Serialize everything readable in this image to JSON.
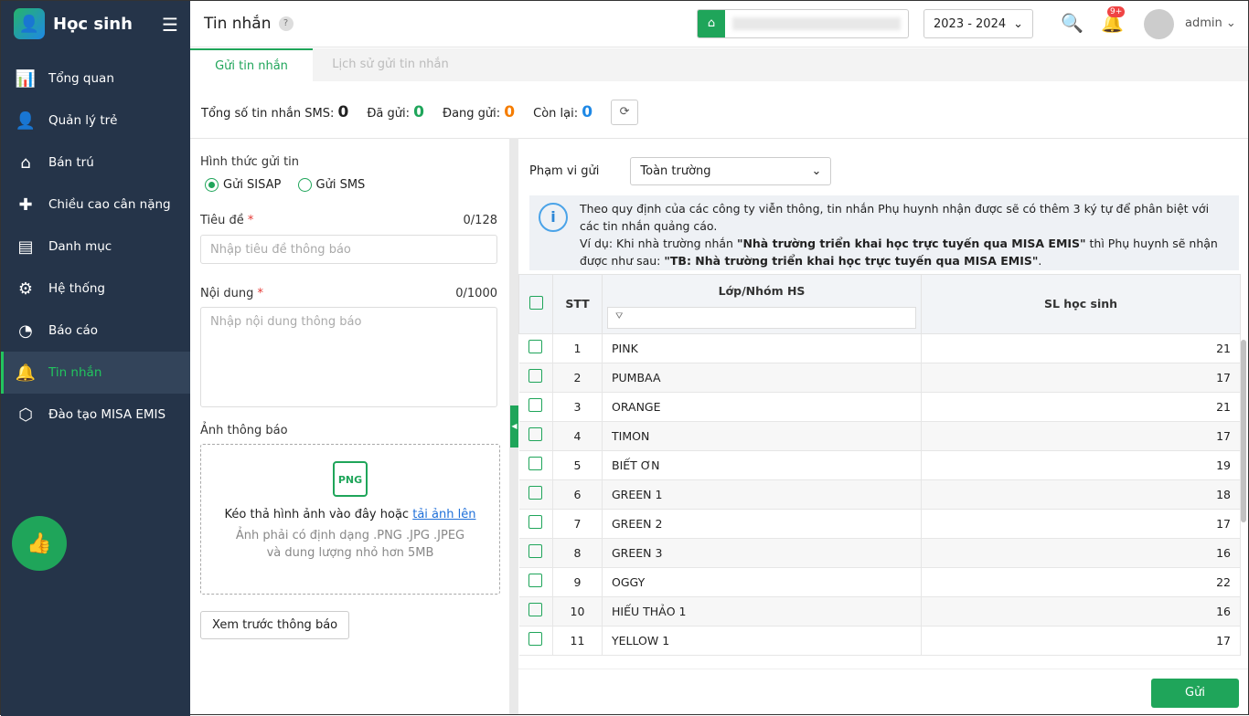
{
  "sidebar": {
    "app_title": "Học sinh",
    "items": [
      {
        "label": "Tổng quan",
        "icon": "chart-icon"
      },
      {
        "label": "Quản lý trẻ",
        "icon": "student-icon"
      },
      {
        "label": "Bán trú",
        "icon": "home-icon"
      },
      {
        "label": "Chiều cao cân nặng",
        "icon": "health-icon"
      },
      {
        "label": "Danh mục",
        "icon": "folder-icon"
      },
      {
        "label": "Hệ thống",
        "icon": "gear-icon"
      },
      {
        "label": "Báo cáo",
        "icon": "pie-icon"
      },
      {
        "label": "Tin nhắn",
        "icon": "bell-icon"
      },
      {
        "label": "Đào tạo MISA EMIS",
        "icon": "box-icon"
      }
    ]
  },
  "header": {
    "title": "Tin nhắn",
    "help": "?",
    "year": "2023 - 2024",
    "notif_badge": "9+",
    "user": "admin"
  },
  "tabs": [
    "Gửi tin nhắn",
    "Lịch sử gửi tin nhắn"
  ],
  "stats": {
    "total_label": "Tổng số tin nhắn SMS:",
    "total": "0",
    "sent_label": "Đã gửi:",
    "sent": "0",
    "sending_label": "Đang gửi:",
    "sending": "0",
    "remain_label": "Còn lại:",
    "remain": "0"
  },
  "colors": {
    "accent": "#1fa55a",
    "sidebar": "#253449",
    "orange": "#f57c00",
    "blue": "#1e88e5"
  },
  "form": {
    "send_type_label": "Hình thức gửi tin",
    "opt_sisap": "Gửi SISAP",
    "opt_sms": "Gửi SMS",
    "title_label": "Tiêu đề",
    "title_count": "0/128",
    "title_placeholder": "Nhập tiêu đề thông báo",
    "content_label": "Nội dung",
    "content_count": "0/1000",
    "content_placeholder": "Nhập nội dung thông báo",
    "image_label": "Ảnh thông báo",
    "png": "PNG",
    "drop_text": "Kéo thả hình ảnh vào đây hoặc",
    "upload_link": "tải ảnh lên",
    "drop_hint": "Ảnh phải có định dạng .PNG .JPG .JPEG và dung lượng nhỏ hơn 5MB",
    "preview_btn": "Xem trước thông báo",
    "required": "*"
  },
  "right": {
    "scope_label": "Phạm vi gửi",
    "scope_value": "Toàn trường",
    "info_line1": "Theo quy định của các công ty viễn thông, tin nhắn Phụ huynh nhận được sẽ có thêm 3 ký tự để phân biệt với các tin nhắn quảng cáo.",
    "info_ex_pre": "Ví dụ: Khi nhà trường nhắn ",
    "info_ex_bold1": "\"Nhà trường triển khai học trực tuyến qua MISA EMIS\"",
    "info_ex_mid": " thì Phụ huynh sẽ nhận được như sau: ",
    "info_ex_bold2": "\"TB: Nhà trường triển khai học trực tuyến qua MISA EMIS\"",
    "info_ex_end": ".",
    "send": "Gửi"
  },
  "table": {
    "headers": {
      "stt": "STT",
      "class": "Lớp/Nhóm HS",
      "count": "SL học sinh"
    },
    "rows": [
      {
        "stt": "1",
        "name": "PINK",
        "count": "21"
      },
      {
        "stt": "2",
        "name": "PUMBAA",
        "count": "17"
      },
      {
        "stt": "3",
        "name": "ORANGE",
        "count": "21"
      },
      {
        "stt": "4",
        "name": "TIMON",
        "count": "17"
      },
      {
        "stt": "5",
        "name": "BIẾT ƠN",
        "count": "19"
      },
      {
        "stt": "6",
        "name": "GREEN 1",
        "count": "18"
      },
      {
        "stt": "7",
        "name": "GREEN 2",
        "count": "17"
      },
      {
        "stt": "8",
        "name": "GREEN 3",
        "count": "16"
      },
      {
        "stt": "9",
        "name": "OGGY",
        "count": "22"
      },
      {
        "stt": "10",
        "name": "HIẾU THẢO 1",
        "count": "16"
      },
      {
        "stt": "11",
        "name": "YELLOW 1",
        "count": "17"
      }
    ]
  }
}
